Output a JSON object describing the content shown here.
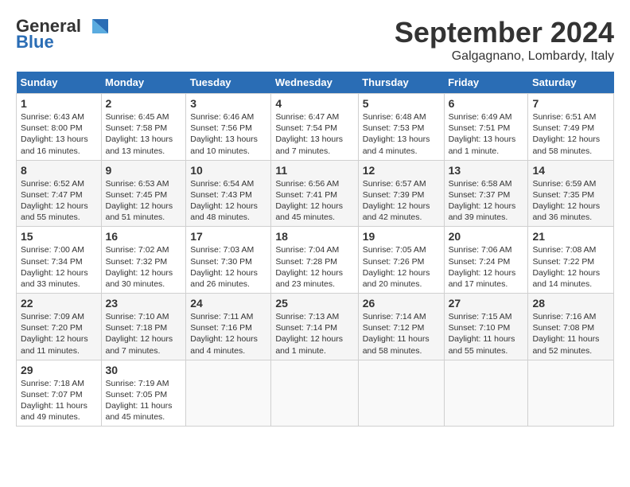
{
  "header": {
    "logo_line1": "General",
    "logo_line2": "Blue",
    "month": "September 2024",
    "location": "Galgagnano, Lombardy, Italy"
  },
  "columns": [
    "Sunday",
    "Monday",
    "Tuesday",
    "Wednesday",
    "Thursday",
    "Friday",
    "Saturday"
  ],
  "weeks": [
    [
      {
        "day": "1",
        "text": "Sunrise: 6:43 AM\nSunset: 8:00 PM\nDaylight: 13 hours\nand 16 minutes."
      },
      {
        "day": "2",
        "text": "Sunrise: 6:45 AM\nSunset: 7:58 PM\nDaylight: 13 hours\nand 13 minutes."
      },
      {
        "day": "3",
        "text": "Sunrise: 6:46 AM\nSunset: 7:56 PM\nDaylight: 13 hours\nand 10 minutes."
      },
      {
        "day": "4",
        "text": "Sunrise: 6:47 AM\nSunset: 7:54 PM\nDaylight: 13 hours\nand 7 minutes."
      },
      {
        "day": "5",
        "text": "Sunrise: 6:48 AM\nSunset: 7:53 PM\nDaylight: 13 hours\nand 4 minutes."
      },
      {
        "day": "6",
        "text": "Sunrise: 6:49 AM\nSunset: 7:51 PM\nDaylight: 13 hours\nand 1 minute."
      },
      {
        "day": "7",
        "text": "Sunrise: 6:51 AM\nSunset: 7:49 PM\nDaylight: 12 hours\nand 58 minutes."
      }
    ],
    [
      {
        "day": "8",
        "text": "Sunrise: 6:52 AM\nSunset: 7:47 PM\nDaylight: 12 hours\nand 55 minutes."
      },
      {
        "day": "9",
        "text": "Sunrise: 6:53 AM\nSunset: 7:45 PM\nDaylight: 12 hours\nand 51 minutes."
      },
      {
        "day": "10",
        "text": "Sunrise: 6:54 AM\nSunset: 7:43 PM\nDaylight: 12 hours\nand 48 minutes."
      },
      {
        "day": "11",
        "text": "Sunrise: 6:56 AM\nSunset: 7:41 PM\nDaylight: 12 hours\nand 45 minutes."
      },
      {
        "day": "12",
        "text": "Sunrise: 6:57 AM\nSunset: 7:39 PM\nDaylight: 12 hours\nand 42 minutes."
      },
      {
        "day": "13",
        "text": "Sunrise: 6:58 AM\nSunset: 7:37 PM\nDaylight: 12 hours\nand 39 minutes."
      },
      {
        "day": "14",
        "text": "Sunrise: 6:59 AM\nSunset: 7:35 PM\nDaylight: 12 hours\nand 36 minutes."
      }
    ],
    [
      {
        "day": "15",
        "text": "Sunrise: 7:00 AM\nSunset: 7:34 PM\nDaylight: 12 hours\nand 33 minutes."
      },
      {
        "day": "16",
        "text": "Sunrise: 7:02 AM\nSunset: 7:32 PM\nDaylight: 12 hours\nand 30 minutes."
      },
      {
        "day": "17",
        "text": "Sunrise: 7:03 AM\nSunset: 7:30 PM\nDaylight: 12 hours\nand 26 minutes."
      },
      {
        "day": "18",
        "text": "Sunrise: 7:04 AM\nSunset: 7:28 PM\nDaylight: 12 hours\nand 23 minutes."
      },
      {
        "day": "19",
        "text": "Sunrise: 7:05 AM\nSunset: 7:26 PM\nDaylight: 12 hours\nand 20 minutes."
      },
      {
        "day": "20",
        "text": "Sunrise: 7:06 AM\nSunset: 7:24 PM\nDaylight: 12 hours\nand 17 minutes."
      },
      {
        "day": "21",
        "text": "Sunrise: 7:08 AM\nSunset: 7:22 PM\nDaylight: 12 hours\nand 14 minutes."
      }
    ],
    [
      {
        "day": "22",
        "text": "Sunrise: 7:09 AM\nSunset: 7:20 PM\nDaylight: 12 hours\nand 11 minutes."
      },
      {
        "day": "23",
        "text": "Sunrise: 7:10 AM\nSunset: 7:18 PM\nDaylight: 12 hours\nand 7 minutes."
      },
      {
        "day": "24",
        "text": "Sunrise: 7:11 AM\nSunset: 7:16 PM\nDaylight: 12 hours\nand 4 minutes."
      },
      {
        "day": "25",
        "text": "Sunrise: 7:13 AM\nSunset: 7:14 PM\nDaylight: 12 hours\nand 1 minute."
      },
      {
        "day": "26",
        "text": "Sunrise: 7:14 AM\nSunset: 7:12 PM\nDaylight: 11 hours\nand 58 minutes."
      },
      {
        "day": "27",
        "text": "Sunrise: 7:15 AM\nSunset: 7:10 PM\nDaylight: 11 hours\nand 55 minutes."
      },
      {
        "day": "28",
        "text": "Sunrise: 7:16 AM\nSunset: 7:08 PM\nDaylight: 11 hours\nand 52 minutes."
      }
    ],
    [
      {
        "day": "29",
        "text": "Sunrise: 7:18 AM\nSunset: 7:07 PM\nDaylight: 11 hours\nand 49 minutes."
      },
      {
        "day": "30",
        "text": "Sunrise: 7:19 AM\nSunset: 7:05 PM\nDaylight: 11 hours\nand 45 minutes."
      },
      null,
      null,
      null,
      null,
      null
    ]
  ]
}
